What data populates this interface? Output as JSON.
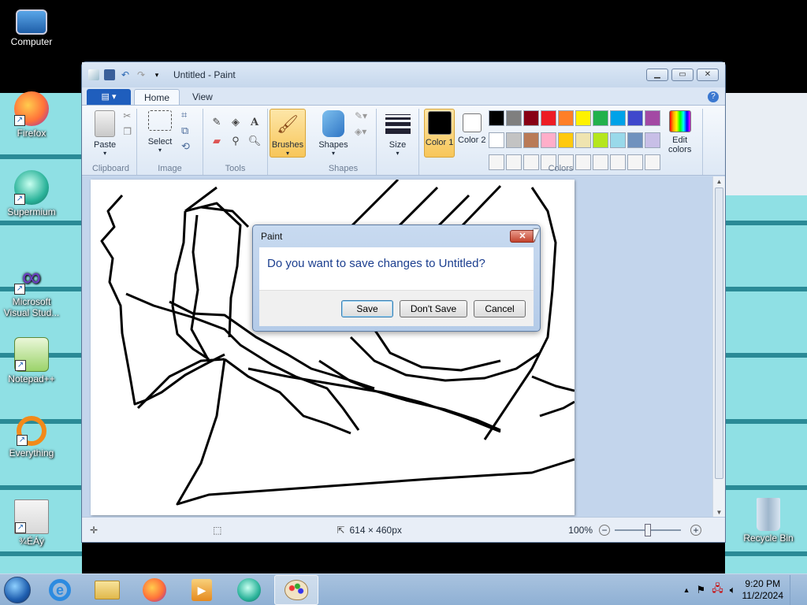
{
  "desktop": {
    "icons": [
      {
        "label": "Computer",
        "icon": "computer-icon"
      },
      {
        "label": "Firefox",
        "icon": "firefox-icon"
      },
      {
        "label": "Supermium",
        "icon": "supermium-icon"
      },
      {
        "label": "Microsoft Visual Stud...",
        "icon": "visual-studio-icon"
      },
      {
        "label": "Notepad++",
        "icon": "notepadpp-icon"
      },
      {
        "label": "Everything",
        "icon": "everything-icon"
      },
      {
        "label": "¾ÉÁý",
        "icon": "app-icon"
      },
      {
        "label": "Recycle Bin",
        "icon": "recycle-bin-icon"
      }
    ]
  },
  "window": {
    "title": "Untitled - Paint",
    "tabs": [
      "Home",
      "View"
    ],
    "file_menu": "▤ ▾"
  },
  "ribbon": {
    "groups": {
      "clipboard": "Clipboard",
      "image": "Image",
      "tools": "Tools",
      "shapes": "Shapes",
      "colors": "Colors"
    },
    "buttons": {
      "paste": "Paste",
      "select": "Select",
      "brushes": "Brushes",
      "shapes": "Shapes",
      "size": "Size",
      "color1": "Color 1",
      "color2": "Color 2",
      "edit_colors": "Edit colors"
    },
    "color1_value": "#000000",
    "color2_value": "#ffffff",
    "palette": [
      "#000000",
      "#7f7f7f",
      "#880015",
      "#ed1c24",
      "#ff7f27",
      "#fff200",
      "#22b14c",
      "#00a2e8",
      "#3f48cc",
      "#a349a4",
      "#ffffff",
      "#c3c3c3",
      "#b97a57",
      "#ffaec9",
      "#ffc90e",
      "#efe4b0",
      "#b5e61d",
      "#99d9ea",
      "#7092be",
      "#c8bfe7",
      "#f5f5f5",
      "#f5f5f5",
      "#f5f5f5",
      "#f5f5f5",
      "#f5f5f5",
      "#f5f5f5",
      "#f5f5f5",
      "#f5f5f5",
      "#f5f5f5",
      "#f5f5f5"
    ]
  },
  "status": {
    "size": "614 × 460px",
    "zoom": "100%"
  },
  "dialog": {
    "title": "Paint",
    "message": "Do you want to save changes to Untitled?",
    "save": "Save",
    "dont_save": "Don't Save",
    "cancel": "Cancel"
  },
  "taskbar": {
    "time": "9:20 PM",
    "date": "11/2/2024"
  }
}
